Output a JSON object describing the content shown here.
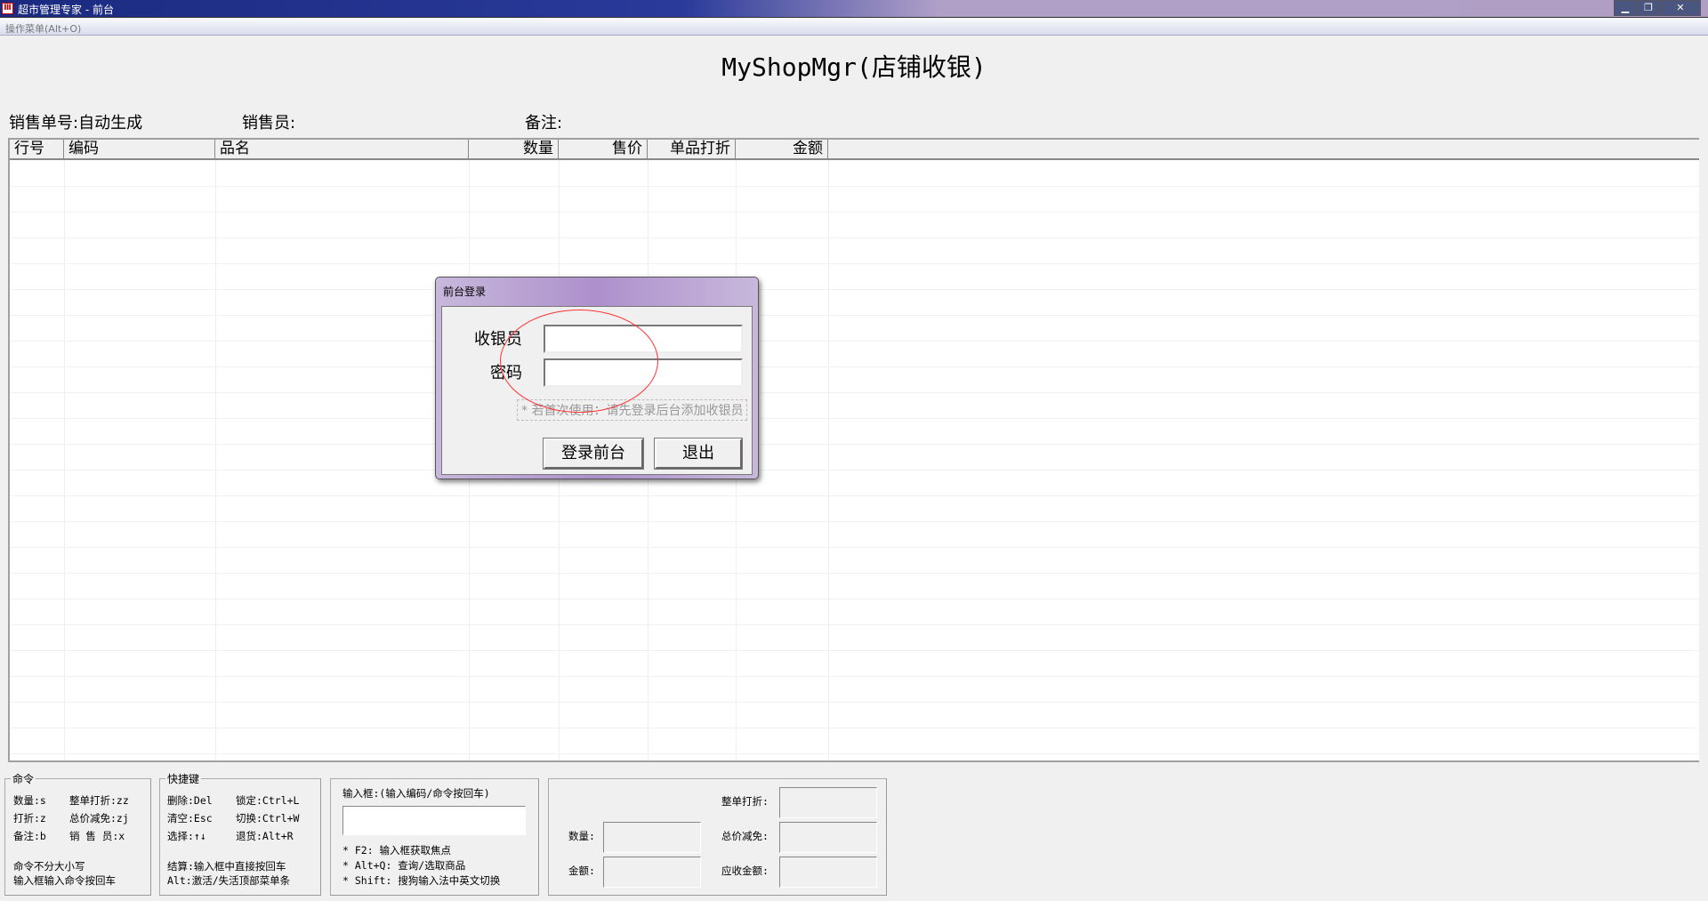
{
  "window": {
    "title": "超市管理专家 - 前台",
    "icon": "app-logo-icon",
    "controls": [
      "minimize-icon",
      "restore-icon",
      "close-icon"
    ]
  },
  "menu": {
    "label": "操作菜单(Alt+O)"
  },
  "app_title": "MyShopMgr(店铺收银)",
  "info": {
    "order_no": "销售单号:自动生成",
    "salesperson": "销售员:",
    "remark": "备注:"
  },
  "table": {
    "columns": [
      "行号",
      "编码",
      "品名",
      "数量",
      "售价",
      "单品打折",
      "金额"
    ],
    "rows": []
  },
  "login": {
    "title": "前台登录",
    "cashier_label": "收银员",
    "cashier_value": "",
    "password_label": "密码",
    "password_value": "",
    "hint": "* 若首次使用：请先登录后台添加收银员",
    "login_button": "登录前台",
    "exit_button": "退出",
    "highlight_color": "#ff0000"
  },
  "commands": {
    "legend": "命令",
    "items": [
      "数量:s",
      "整单打折:zz",
      "打折:z",
      "总价减免:zj",
      "备注:b",
      "销 售 员:x"
    ],
    "note1": "命令不分大小写",
    "note2": "输入框输入命令按回车"
  },
  "shortcuts": {
    "legend": "快捷键",
    "items": [
      "删除:Del",
      "锁定:Ctrl+L",
      "清空:Esc",
      "切换:Ctrl+W",
      "选择:↑↓",
      "退货:Alt+R"
    ],
    "note1": "结算:输入框中直接按回车",
    "note2": "Alt:激活/失活顶部菜单条"
  },
  "input_panel": {
    "label": "输入框:(输入编码/命令按回车)",
    "value": "",
    "tips": [
      "* F2: 输入框获取焦点",
      "* Alt+Q: 查询/选取商品",
      "* Shift: 搜狗输入法中英文切换"
    ]
  },
  "totals": {
    "qty_label": "数量:",
    "amount_label": "金额:",
    "discount_label": "整单打折:",
    "reduction_label": "总价减免:",
    "receivable_label": "应收金额:"
  }
}
